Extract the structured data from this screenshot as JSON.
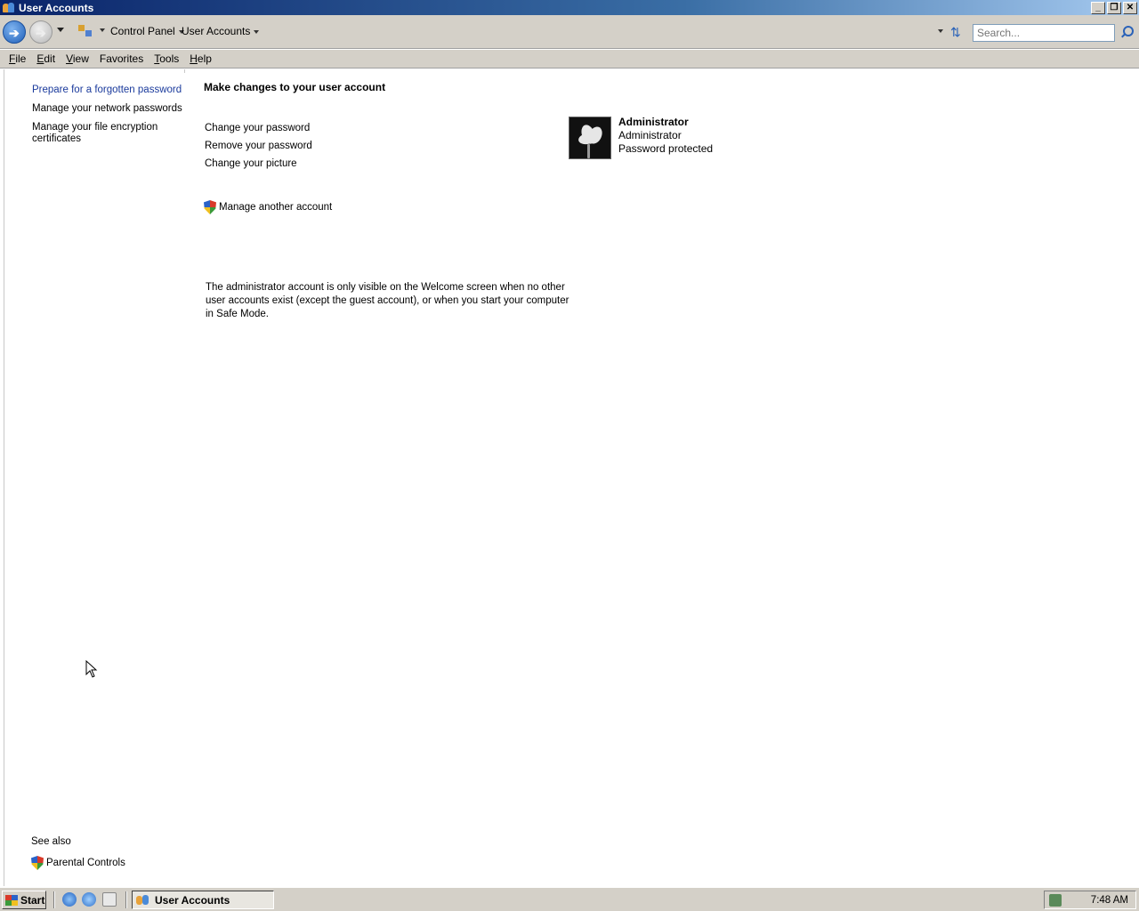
{
  "window": {
    "title": "User Accounts",
    "buttons": {
      "minimize": "_",
      "restore": "❐",
      "close": "✕"
    }
  },
  "address": {
    "breadcrumbs": [
      "Control Panel",
      "User Accounts"
    ],
    "search_placeholder": "Search..."
  },
  "menu": {
    "items": [
      {
        "accel": "F",
        "rest": "ile"
      },
      {
        "accel": "E",
        "rest": "dit"
      },
      {
        "accel": "V",
        "rest": "iew"
      },
      {
        "accel": "",
        "rest": "Favorites",
        "accel_pos": "a"
      },
      {
        "accel": "T",
        "rest": "ools"
      },
      {
        "accel": "H",
        "rest": "elp"
      }
    ]
  },
  "left_pane": {
    "tasks": [
      "Prepare for a forgotten password",
      "Manage your network passwords",
      "Manage your file encryption certificates"
    ],
    "see_also_label": "See also",
    "see_also_items": [
      "Parental Controls"
    ]
  },
  "main": {
    "heading": "Make changes to your user account",
    "actions": [
      "Change your password",
      "Remove your password",
      "Change your picture"
    ],
    "manage_another": "Manage another account",
    "note": "The administrator account is only visible on the Welcome screen when no other user accounts exist (except the guest account), or when you start your computer in Safe Mode."
  },
  "account": {
    "name": "Administrator",
    "type": "Administrator",
    "status": "Password protected"
  },
  "taskbar": {
    "start_label": "Start",
    "task_label": "User Accounts",
    "clock": "7:48 AM"
  }
}
